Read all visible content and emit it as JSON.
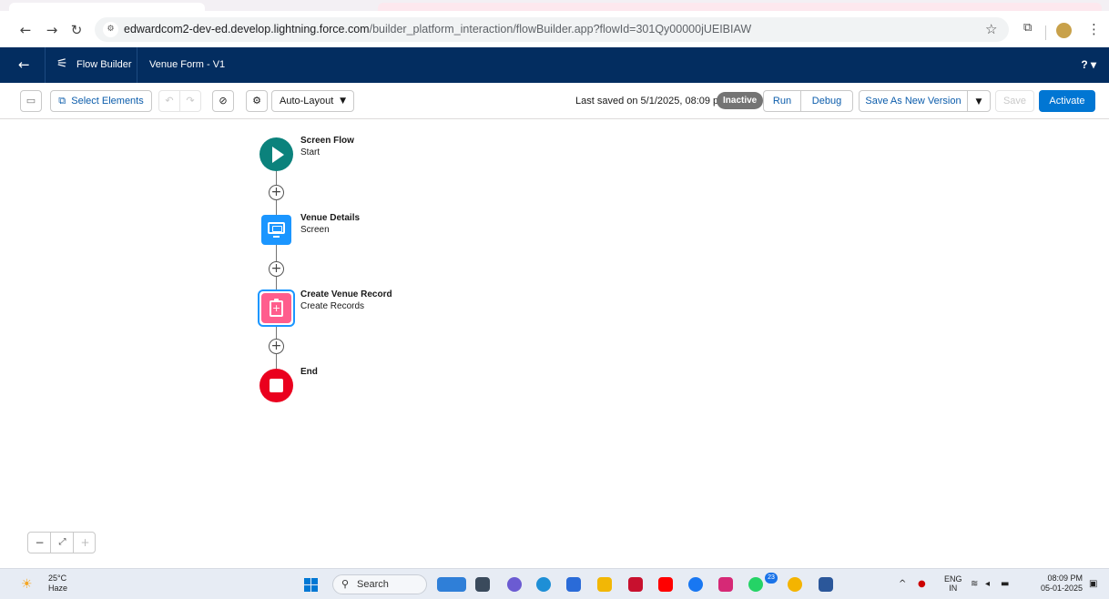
{
  "browser": {
    "url_host": "edwardcom2-dev-ed.develop.lightning.force.com",
    "url_path": "/builder_platform_interaction/flowBuilder.app?flowId=301Qy00000jUEIBIAW"
  },
  "header": {
    "app_name": "Flow Builder",
    "flow_name": "Venue Form - V1",
    "help_label": "? ▾"
  },
  "toolbar": {
    "select_elements": "Select Elements",
    "layout_mode": "Auto-Layout",
    "last_saved": "Last saved on 5/1/2025, 08:09 pm",
    "status_badge": "Inactive",
    "run": "Run",
    "debug": "Debug",
    "save_as_new_version": "Save As New Version",
    "save": "Save",
    "activate": "Activate"
  },
  "flow": {
    "nodes": [
      {
        "title": "Screen Flow",
        "subtitle": "Start"
      },
      {
        "title": "Venue Details",
        "subtitle": "Screen"
      },
      {
        "title": "Create Venue Record",
        "subtitle": "Create Records"
      },
      {
        "title": "End",
        "subtitle": ""
      }
    ]
  },
  "taskbar": {
    "temperature": "25°C",
    "weather": "Haze",
    "search": "Search",
    "lang_top": "ENG",
    "lang_bottom": "IN",
    "time": "08:09 PM",
    "date": "05-01-2025",
    "whatsapp_badge": "23"
  },
  "colors": {
    "header_bg": "#032d60",
    "brand": "#0176d3",
    "start": "#0b827c",
    "screen": "#1b96ff",
    "record": "#ff5d8d",
    "end": "#ea001e"
  }
}
